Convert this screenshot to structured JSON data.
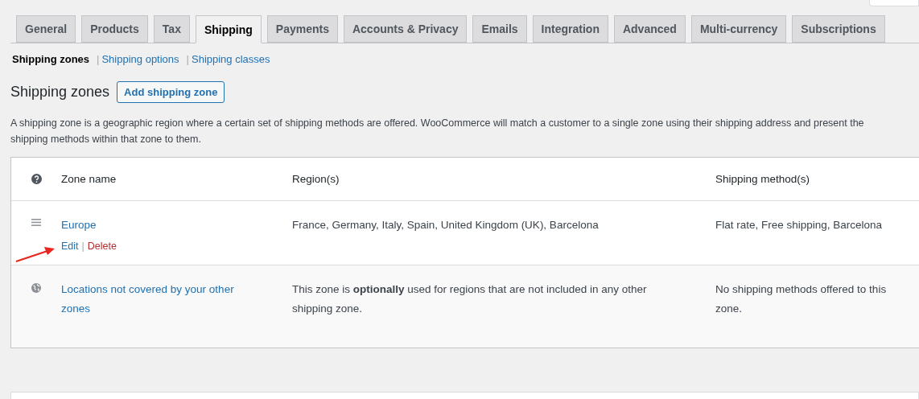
{
  "tabs": [
    {
      "label": "General",
      "selected": false
    },
    {
      "label": "Products",
      "selected": false
    },
    {
      "label": "Tax",
      "selected": false
    },
    {
      "label": "Shipping",
      "selected": true
    },
    {
      "label": "Payments",
      "selected": false
    },
    {
      "label": "Accounts & Privacy",
      "selected": false
    },
    {
      "label": "Emails",
      "selected": false
    },
    {
      "label": "Integration",
      "selected": false
    },
    {
      "label": "Advanced",
      "selected": false
    },
    {
      "label": "Multi-currency",
      "selected": false
    },
    {
      "label": "Subscriptions",
      "selected": false
    }
  ],
  "subnav": [
    {
      "label": "Shipping zones",
      "selected": true
    },
    {
      "label": "Shipping options",
      "selected": false
    },
    {
      "label": "Shipping classes",
      "selected": false
    }
  ],
  "subnav_separator": "|",
  "heading": "Shipping zones",
  "add_button": "Add shipping zone",
  "description": "A shipping zone is a geographic region where a certain set of shipping methods are offered. WooCommerce will match a customer to a single zone using their shipping address and present the shipping methods within that zone to them.",
  "table": {
    "columns": [
      "Zone name",
      "Region(s)",
      "Shipping method(s)"
    ],
    "rows": [
      {
        "kind": "zone",
        "name": "Europe",
        "regions": "France, Germany, Italy, Spain, United Kingdom (UK), Barcelona",
        "methods": "Flat rate, Free shipping, Barcelona",
        "actions": [
          "Edit",
          "Delete"
        ],
        "action_separator": "|",
        "annotated": true
      },
      {
        "kind": "rest",
        "name": "Locations not covered by your other zones",
        "regions": "This zone is **optionally** used for regions that are not included in any other shipping zone.",
        "methods": "No shipping methods offered to this zone."
      }
    ]
  }
}
